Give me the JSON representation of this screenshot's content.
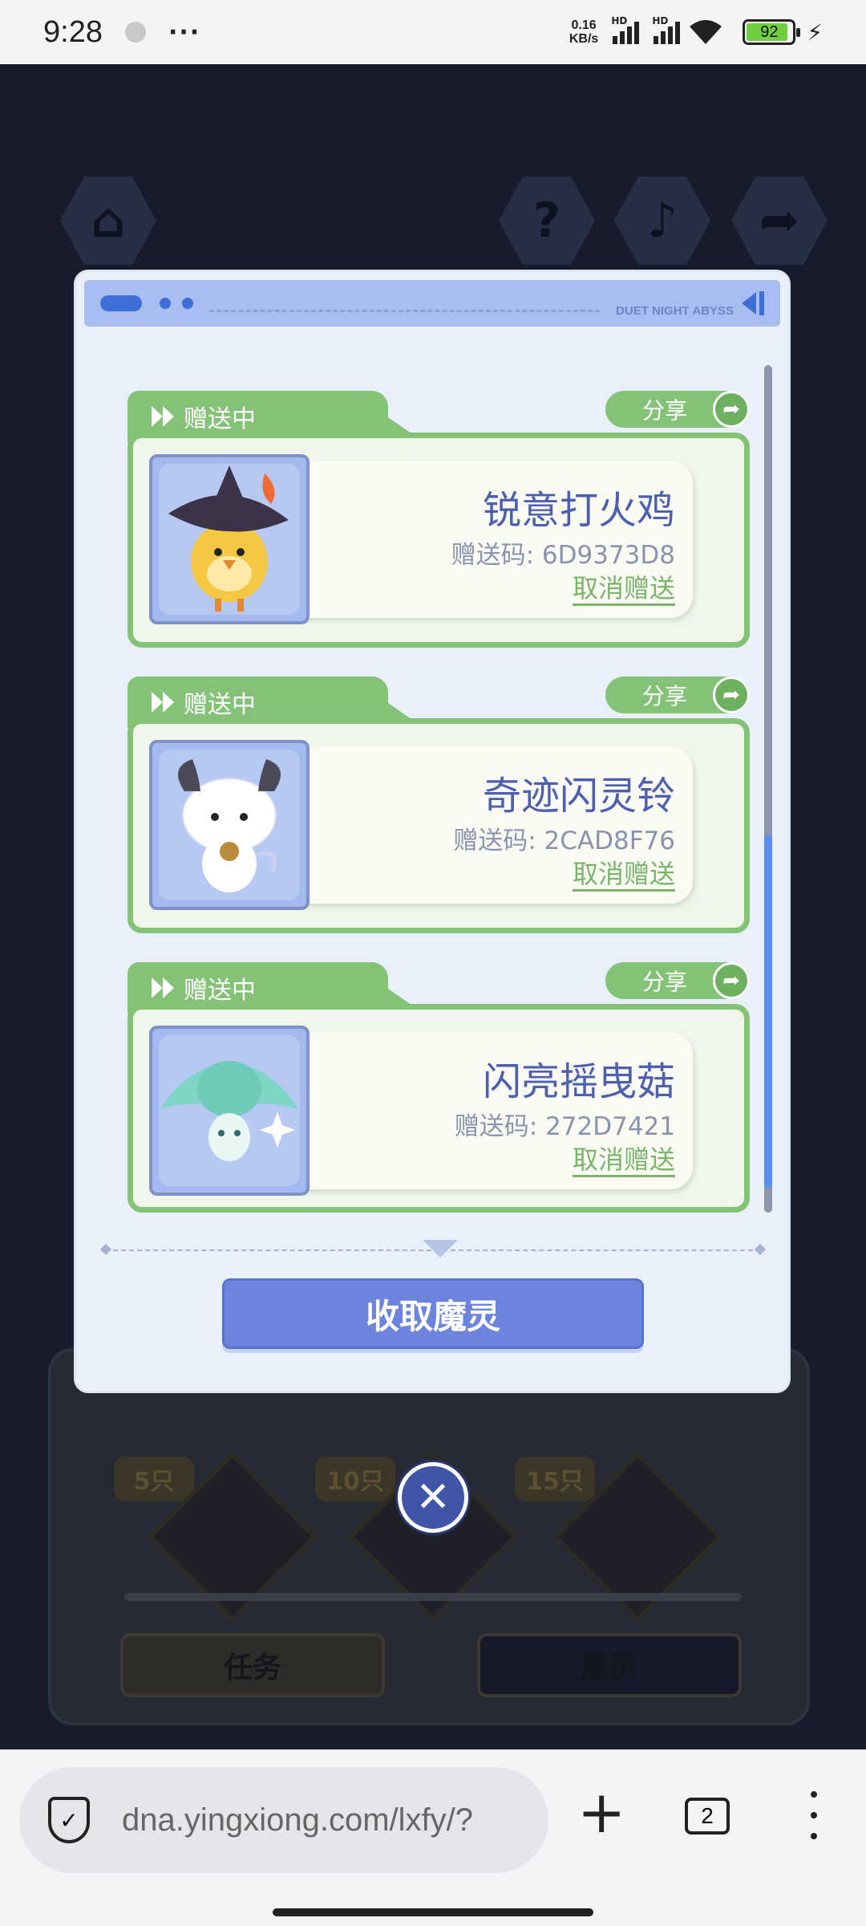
{
  "status": {
    "time": "9:28",
    "more": "···",
    "speed_top": "0.16",
    "speed_bottom": "KB/s",
    "hd1": "HD",
    "hd2": "HD",
    "battery": "92"
  },
  "game": {
    "badges": [
      "5只",
      "10只",
      "15只"
    ],
    "buttons": [
      "任务",
      "魔灵"
    ]
  },
  "dialog": {
    "header_text": "DUET NIGHT ABYSS",
    "collect_label": "收取魔灵",
    "gifts": [
      {
        "status": "赠送中",
        "share": "分享",
        "name": "锐意打火鸡",
        "code": "赠送码: 6D9373D8",
        "cancel": "取消赠送"
      },
      {
        "status": "赠送中",
        "share": "分享",
        "name": "奇迹闪灵铃",
        "code": "赠送码: 2CAD8F76",
        "cancel": "取消赠送"
      },
      {
        "status": "赠送中",
        "share": "分享",
        "name": "闪亮摇曳菇",
        "code": "赠送码: 272D7421",
        "cancel": "取消赠送"
      }
    ]
  },
  "browser": {
    "url": "dna.yingxiong.com/lxfy/?",
    "tab_count": "2"
  },
  "icons": {
    "home": "home-icon",
    "help": "help-icon",
    "music": "music-icon",
    "share": "share-icon",
    "close": "close-icon",
    "shield": "shield-icon"
  },
  "colors": {
    "accent_green": "#84c277",
    "accent_blue": "#6d84df",
    "name_text": "#4d5fae"
  }
}
